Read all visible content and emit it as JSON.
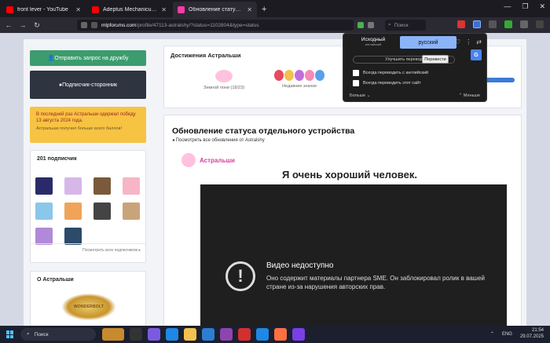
{
  "tabs": [
    {
      "title": "front lever - YouTube",
      "favicon": "youtube-icon"
    },
    {
      "title": "Adeptus Mechanicus - Omnissi",
      "favicon": "youtube-icon"
    },
    {
      "title": "Обновление статуса сингла от",
      "favicon": "mlp-forums-icon",
      "active": true
    }
  ],
  "address_bar": {
    "host": "mlpforums.com",
    "path": "/profile/47113-astralshy/?status=1102804&type=status"
  },
  "search": {
    "placeholder": "Поиск"
  },
  "sidebar": {
    "friend_request": "Отправить запрос на дружбу",
    "follow": "Подписчик-сторонник",
    "notice_line1": "В последний раз Астральши одержал победу 13 августа 2024 года.",
    "notice_line2": "Астральши получил больше всего баллов!",
    "subscribers_title": "201 подписчик",
    "see_all": "Посмотреть всех подписчиков ▸",
    "about_title": "О Астральши",
    "logo_text": "WONDERBOLT"
  },
  "achievements": {
    "title": "Достижения Астральши",
    "items": [
      {
        "label": "Земной пони (18/23)"
      },
      {
        "label": "Недавние значки"
      }
    ]
  },
  "status": {
    "title": "Обновление статуса отдельного устройства",
    "back_link": "◂ Посмотреть все обновления от Astralshy",
    "author": "Астральши",
    "post_text": "Я очень хороший человек.",
    "video_title": "Видео недоступно",
    "video_message": "Оно содержит материалы партнера SME. Он заблокировал ролик в вашей стране из-за нарушения авторских прав."
  },
  "translate_popup": {
    "source_label": "Исходный",
    "source_sub": "английский",
    "target_label": "русский",
    "improve": "Улучшить перевод",
    "translate_btn": "Перевести",
    "always_lang": "Всегда переводить с английский",
    "always_site": "Всегда переводить этот сайт",
    "more": "Больше",
    "less": "Меньше"
  },
  "taskbar": {
    "search_label": "Поиск",
    "lang": "ENG",
    "time": "21:54",
    "date": "29.07.2025"
  },
  "colors": {
    "green_button": "#3c9c6e",
    "dark_button": "#2e3440",
    "notice_bg": "#f6c343",
    "author_pink": "#d63fa0",
    "translate_accent": "#8ab4f8"
  }
}
